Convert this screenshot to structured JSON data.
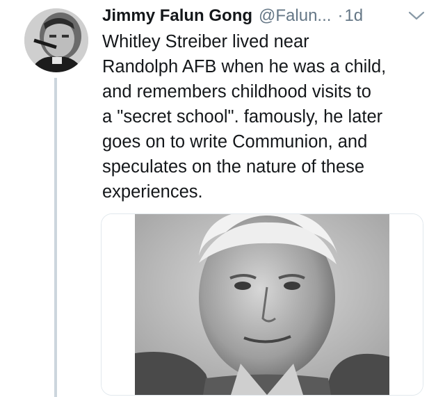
{
  "tweet": {
    "author_name": "Jimmy Falun Gong",
    "handle": "@Falun...",
    "separator": "·",
    "time": "1d",
    "text": "Whitley Streiber lived near\nRandolph AFB when he was a child,\nand remembers childhood visits to\na \"secret school\". famously, he later\ngoes on to write Communion, and\nspeculates on the nature of these\nexperiences."
  },
  "icons": {
    "avatar": "avatar-photo",
    "menu": "chevron-down-icon"
  },
  "colors": {
    "text": "#14171a",
    "secondary": "#657786",
    "thread_line": "#ccd6dd",
    "border": "#e1e8ed"
  }
}
